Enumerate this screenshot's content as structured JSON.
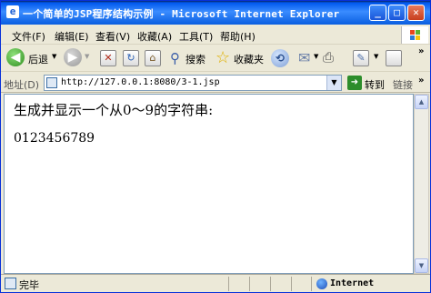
{
  "window": {
    "title": "一个简单的JSP程序结构示例 - Microsoft Internet Explorer",
    "minimize_glyph": "_",
    "maximize_glyph": "□",
    "close_glyph": "✕"
  },
  "menubar": {
    "items": [
      "文件(F)",
      "编辑(E)",
      "查看(V)",
      "收藏(A)",
      "工具(T)",
      "帮助(H)"
    ]
  },
  "toolbar": {
    "back_label": "后退",
    "search_label": "搜索",
    "favorites_label": "收藏夹",
    "icons": [
      "back-icon",
      "forward-icon",
      "stop-icon",
      "refresh-icon",
      "home-icon",
      "search-icon",
      "favorites-star-icon",
      "history-icon",
      "mail-icon",
      "print-icon",
      "edit-icon",
      "discuss-icon"
    ]
  },
  "addressbar": {
    "label": "地址(D)",
    "url": "http://127.0.0.1:8080/3-1.jsp",
    "go_label": "转到",
    "links_label": "链接"
  },
  "content": {
    "heading": "生成并显示一个从0～9的字符串:",
    "digits": "0123456789"
  },
  "statusbar": {
    "status": "完毕",
    "zone": "Internet"
  }
}
